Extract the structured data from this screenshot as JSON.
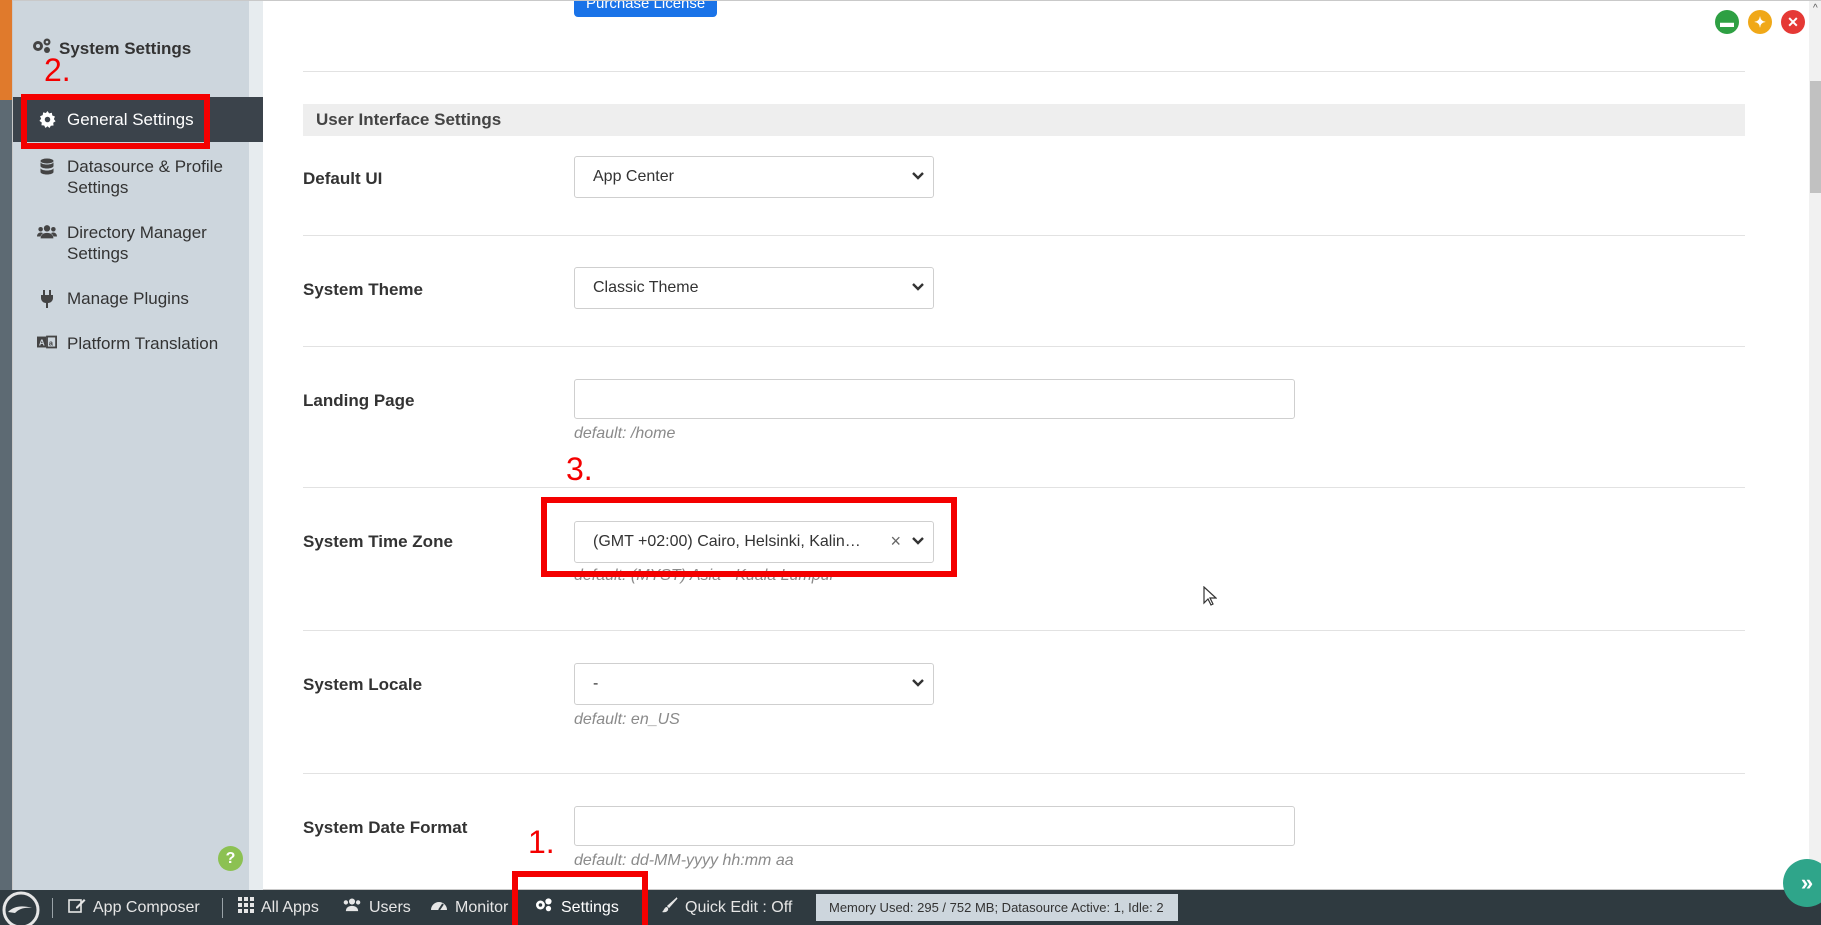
{
  "sidebar": {
    "title": "System Settings",
    "items": [
      {
        "label": "General Settings",
        "icon": "gear-icon"
      },
      {
        "label": "Datasource & Profile\nSettings",
        "icon": "database-icon"
      },
      {
        "label": "Directory Manager\nSettings",
        "icon": "users-icon"
      },
      {
        "label": "Manage Plugins",
        "icon": "plug-icon"
      },
      {
        "label": "Platform Translation",
        "icon": "translate-icon"
      }
    ],
    "help": "?"
  },
  "main": {
    "purchase_button": "Purchase License",
    "section_title": "User Interface Settings",
    "fields": {
      "default_ui": {
        "label": "Default UI",
        "value": "App Center"
      },
      "system_theme": {
        "label": "System Theme",
        "value": "Classic Theme"
      },
      "landing_page": {
        "label": "Landing Page",
        "value": "",
        "hint": "default: /home"
      },
      "time_zone": {
        "label": "System Time Zone",
        "value": "(GMT +02:00) Cairo, Helsinki, Kalin…",
        "hint": "default: (MYST) Asia - Kuala Lumpur"
      },
      "locale": {
        "label": "System Locale",
        "value": "-",
        "hint": "default: en_US"
      },
      "date_format": {
        "label": "System Date Format",
        "value": "",
        "hint": "default: dd-MM-yyyy hh:mm aa"
      }
    }
  },
  "annotations": {
    "step1": "1.",
    "step2": "2.",
    "step3": "3."
  },
  "taskbar": {
    "app_composer": "App Composer",
    "all_apps": "All Apps",
    "users": "Users",
    "monitor": "Monitor",
    "settings": "Settings",
    "quick_edit": "Quick Edit : Off",
    "memory": "Memory Used: 295 / 752 MB; Datasource Active: 1, Idle: 2"
  },
  "colors": {
    "annotation": "#f40000",
    "accent": "#1a73e8",
    "sidebar_active": "#3b434b"
  }
}
